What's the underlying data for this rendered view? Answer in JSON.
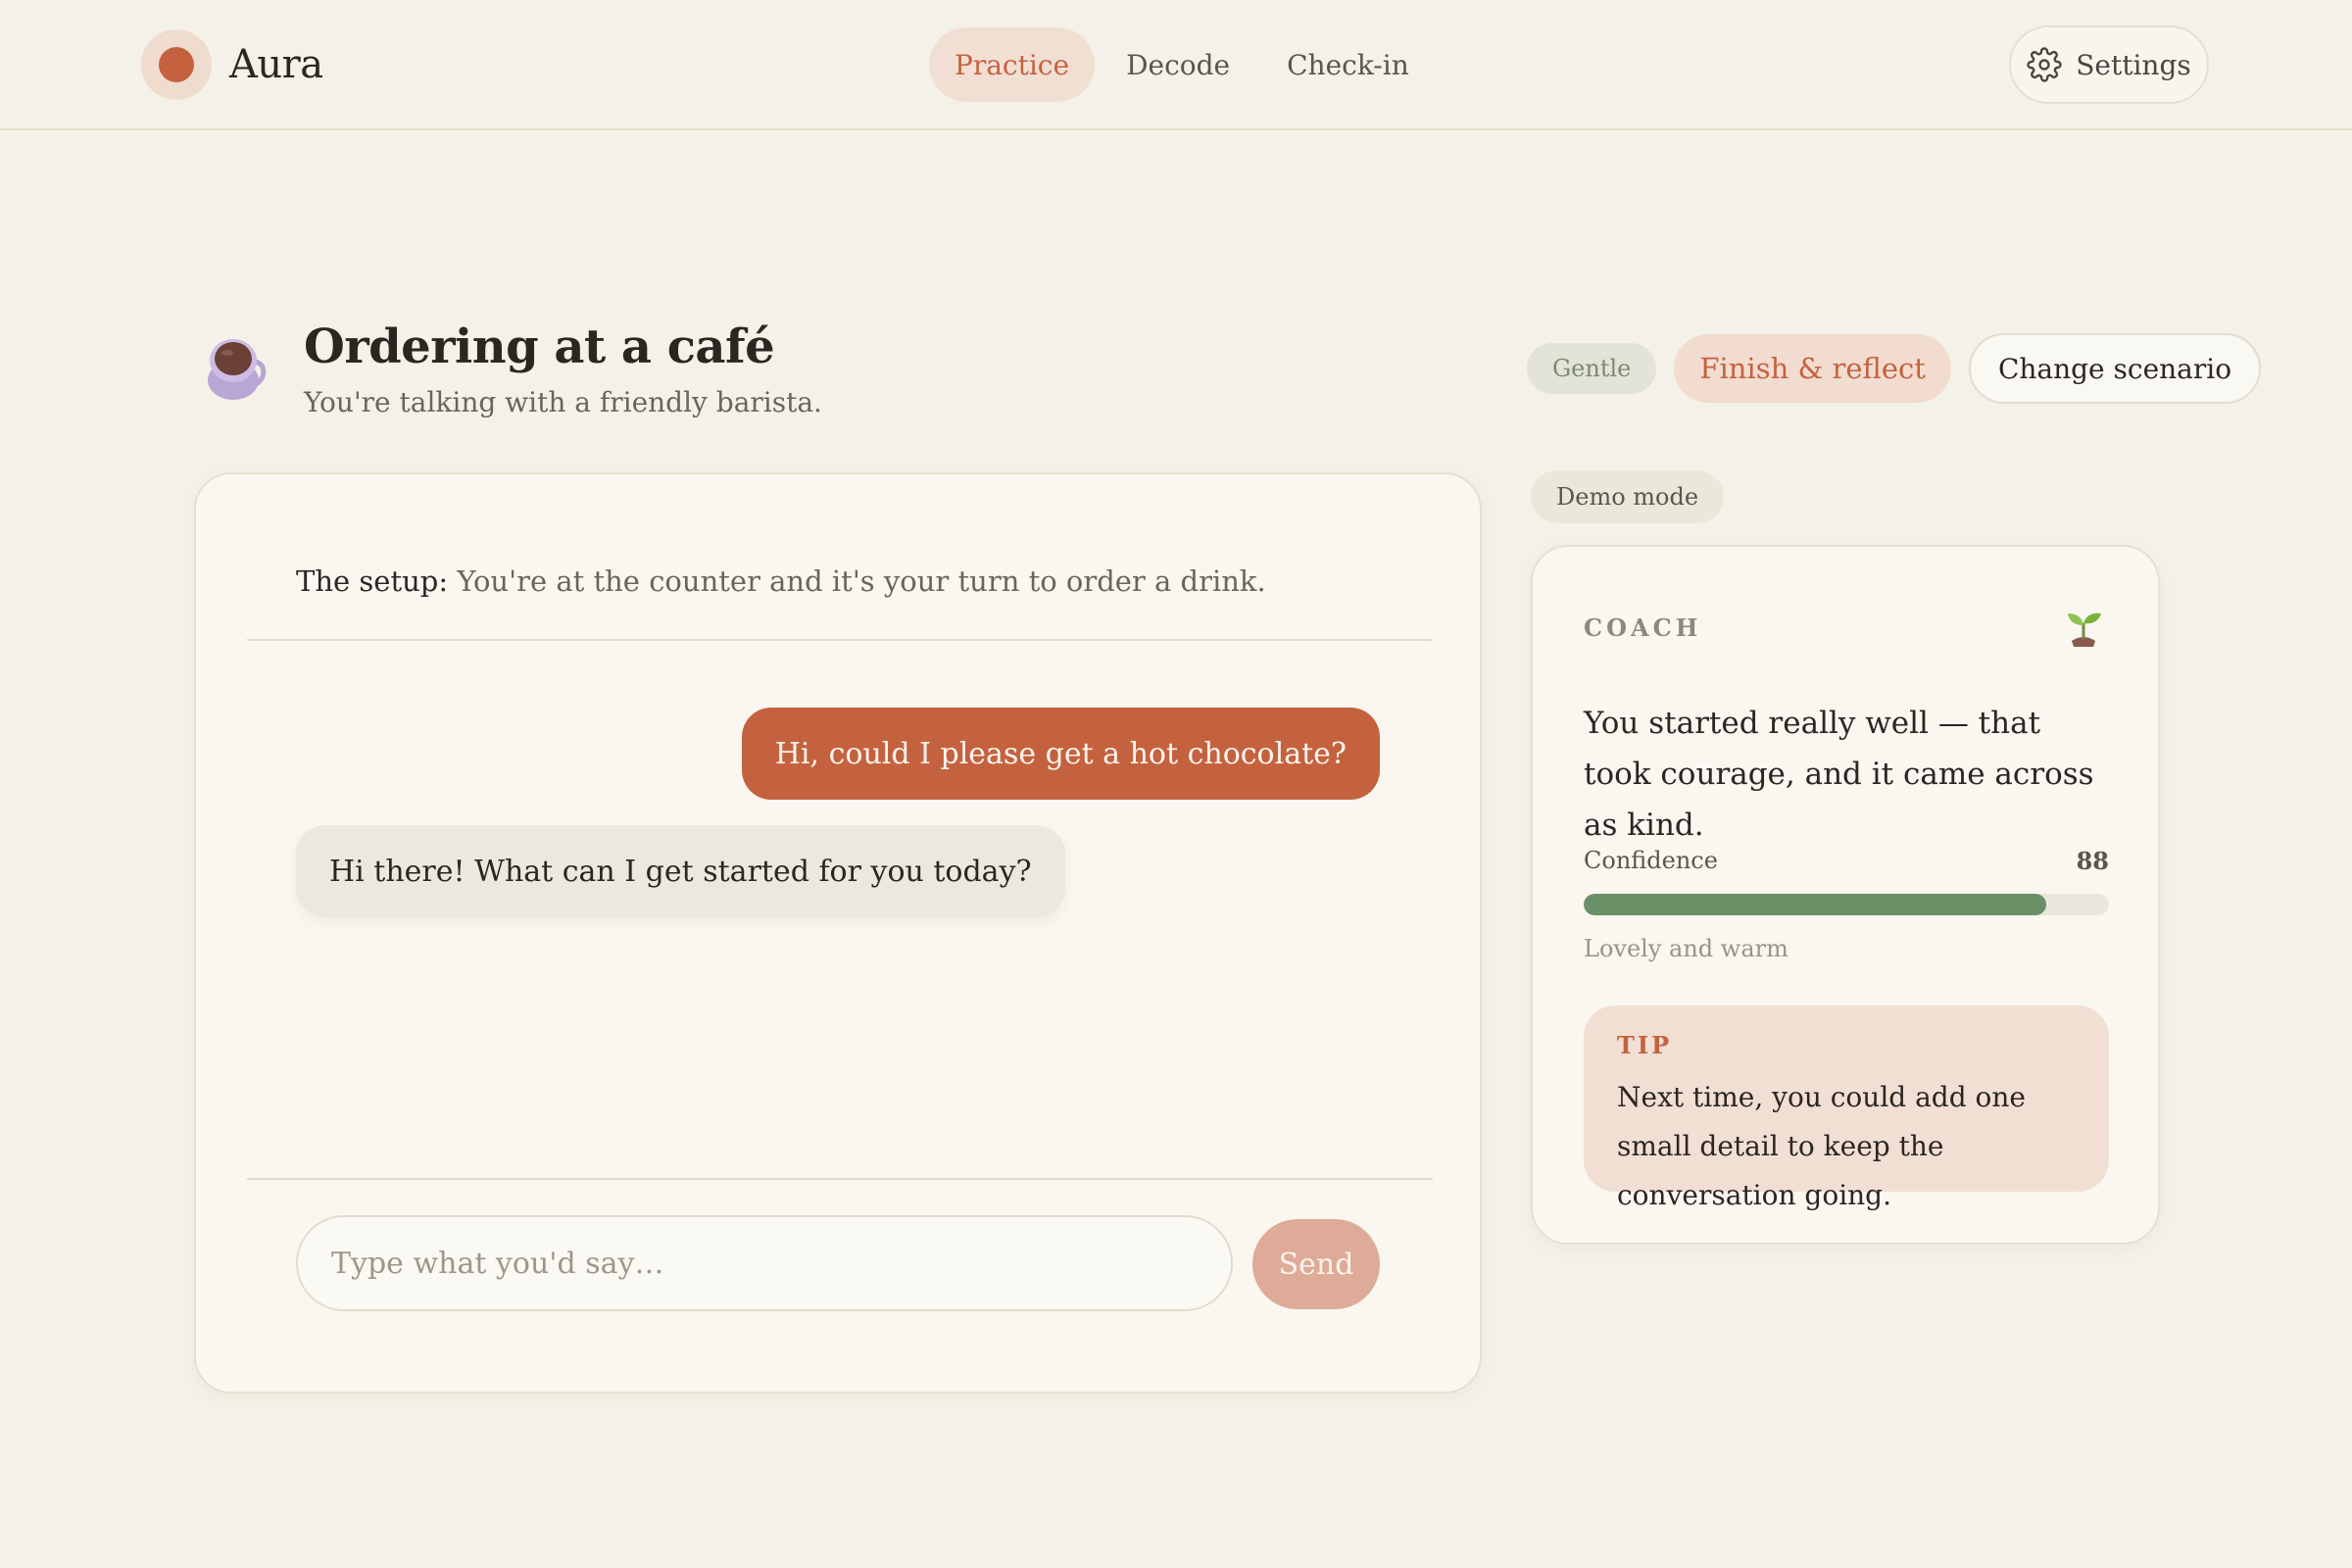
{
  "app": {
    "name": "Aura",
    "accent_color": "#c4623f"
  },
  "nav": {
    "items": [
      {
        "label": "Practice",
        "active": true
      },
      {
        "label": "Decode",
        "active": false
      },
      {
        "label": "Check-in",
        "active": false
      }
    ],
    "settings_label": "Settings",
    "settings_icon": "gear-icon"
  },
  "scenario": {
    "icon": "coffee-cup-icon",
    "title": "Ordering at a café",
    "subtitle": "You're talking with a friendly barista.",
    "tone_badge": "Gentle",
    "finish_label": "Finish & reflect",
    "change_label": "Change scenario"
  },
  "chat": {
    "setup_label": "The setup:",
    "setup_text": " You're at the counter and it's your turn to order a drink.",
    "messages": [
      {
        "role": "user",
        "text": "Hi, could I please get a hot chocolate?"
      },
      {
        "role": "assistant",
        "text": "Hi there! What can I get started for you today?"
      }
    ],
    "input_placeholder": "Type what you'd say…",
    "input_value": "",
    "send_label": "Send"
  },
  "coach": {
    "demo_badge": "Demo mode",
    "label": "COACH",
    "icon": "sprout-icon",
    "message": "You started really well — that took courage, and it came across as kind.",
    "metric_label": "Confidence",
    "metric_value": "88",
    "metric_percent": 88,
    "metric_color": "#6a9068",
    "metric_caption": "Lovely and warm",
    "tip_label": "TIP",
    "tip_text": "Next time, you could add one small detail to keep the conversation going."
  }
}
